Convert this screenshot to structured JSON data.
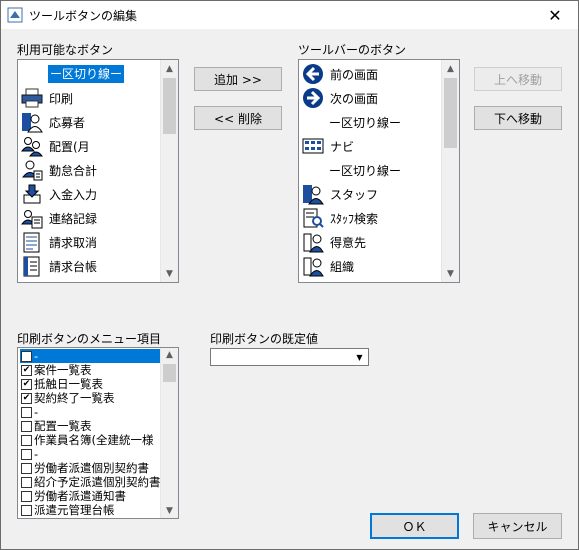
{
  "window": {
    "title": "ツールボタンの編集",
    "close_glyph": "✕"
  },
  "available": {
    "label": "利用可能なボタン",
    "items": [
      {
        "icon": "separator",
        "text": "ー区切り線ー",
        "selected": true
      },
      {
        "icon": "printer-icon",
        "text": "印刷"
      },
      {
        "icon": "applicant-icon",
        "text": "応募者"
      },
      {
        "icon": "assignment-icon",
        "text": "配置(月"
      },
      {
        "icon": "attendance-icon",
        "text": "勤怠合計"
      },
      {
        "icon": "deposit-icon",
        "text": "入金入力"
      },
      {
        "icon": "contact-record-icon",
        "text": "連絡記録"
      },
      {
        "icon": "invoice-cancel-icon",
        "text": "請求取消"
      },
      {
        "icon": "invoice-ledger-icon",
        "text": "請求台帳"
      }
    ]
  },
  "buttons": {
    "add": "追加 >>",
    "remove": "<< 削除",
    "move_up": "上へ移動",
    "move_down": "下へ移動",
    "ok": "ＯＫ",
    "cancel": "キャンセル"
  },
  "toolbar": {
    "label": "ツールバーのボタン",
    "items": [
      {
        "icon": "prev-screen-icon",
        "text": "前の画面"
      },
      {
        "icon": "next-screen-icon",
        "text": "次の画面"
      },
      {
        "icon": "separator",
        "text": "ー区切り線ー"
      },
      {
        "icon": "navi-icon",
        "text": "ナビ"
      },
      {
        "icon": "separator",
        "text": "ー区切り線ー"
      },
      {
        "icon": "staff-icon",
        "text": "スタッフ"
      },
      {
        "icon": "staff-search-icon",
        "text": "ｽﾀｯﾌ検索"
      },
      {
        "icon": "client-icon",
        "text": "得意先"
      },
      {
        "icon": "organization-icon",
        "text": "組織"
      }
    ]
  },
  "print_menu": {
    "label": "印刷ボタンのメニュー項目",
    "items": [
      {
        "text": "-",
        "checked": false,
        "selected": true
      },
      {
        "text": "案件一覧表",
        "checked": true
      },
      {
        "text": "抵触日一覧表",
        "checked": true
      },
      {
        "text": "契約終了一覧表",
        "checked": true
      },
      {
        "text": "-",
        "checked": false
      },
      {
        "text": "配置一覧表",
        "checked": false
      },
      {
        "text": "作業員名簿(全建統一様",
        "checked": false
      },
      {
        "text": "-",
        "checked": false
      },
      {
        "text": "労働者派遣個別契約書",
        "checked": false
      },
      {
        "text": "紹介予定派遣個別契約書",
        "checked": false
      },
      {
        "text": "労働者派遣通知書",
        "checked": false
      },
      {
        "text": "派遣元管理台帳",
        "checked": false
      }
    ]
  },
  "print_default": {
    "label": "印刷ボタンの既定値",
    "value": ""
  },
  "colors": {
    "selection": "#0078d7",
    "accent_blue": "#1c4fa0"
  }
}
